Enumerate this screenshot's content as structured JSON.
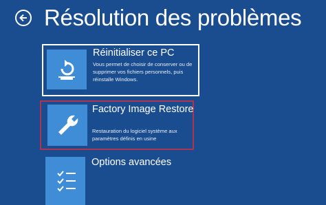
{
  "header": {
    "title": "Résolution des problèmes"
  },
  "options": [
    {
      "title": "Réinitialiser ce PC",
      "description": "Vous permet de choisir de conserver ou de supprimer vos fichiers personnels, puis réinstalle Windows.",
      "icon": "reset-pc-icon"
    },
    {
      "title": "Factory Image Restore",
      "description": "Restauration du logiciel système aux paramètres définis en usine",
      "icon": "wrench-icon"
    },
    {
      "title": "Options avancées",
      "description": "",
      "icon": "checklist-icon"
    }
  ],
  "colors": {
    "background": "#1a4d8f",
    "tile": "#3f8dd6",
    "selection_border": "#b0344f"
  }
}
